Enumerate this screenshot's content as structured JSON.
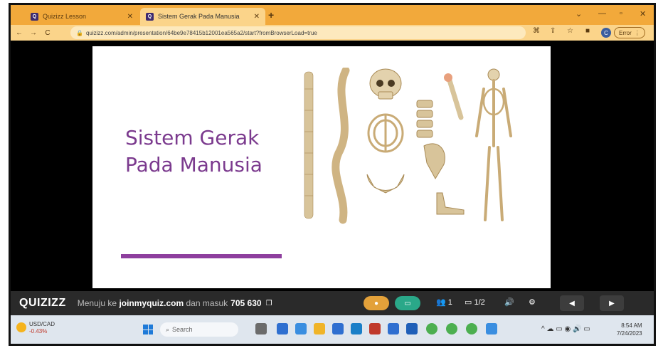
{
  "browser": {
    "tabs": [
      {
        "label": "Quizizz Lesson",
        "active": false
      },
      {
        "label": "Sistem Gerak Pada Manusia",
        "active": true
      }
    ],
    "new_tab": "+",
    "url": "quizizz.com/admin/presentation/64be9e78415b12001ea565a2/start?fromBrowserLoad=true",
    "profile_initial": "C",
    "error_label": "Error"
  },
  "slide": {
    "title_line1": "Sistem Gerak",
    "title_line2": "Pada Manusia",
    "accent_color": "#8e3f9e"
  },
  "quizizz_bar": {
    "logo": "QUIZIZZ",
    "join_prefix": "Menuju ke",
    "join_site": "joinmyquiz.com",
    "join_middle": "dan masuk",
    "join_code": "705 630",
    "participants": "1",
    "slide_counter": "1/2"
  },
  "taskbar": {
    "ticker_symbol": "USD/CAD",
    "ticker_change": "-0.43%",
    "search_placeholder": "Search",
    "time": "8:54 AM",
    "date": "7/24/2023"
  }
}
